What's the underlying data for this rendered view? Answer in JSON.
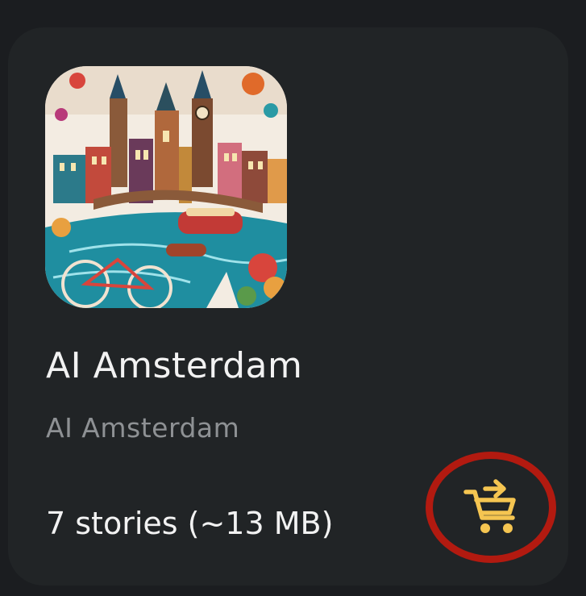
{
  "card": {
    "cover_alt": "AI Amsterdam cover art",
    "title": "AI Amsterdam",
    "subtitle": "AI Amsterdam",
    "meta": "7 stories (~13 MB)"
  },
  "action": {
    "icon": "cart-transfer-icon",
    "color": "#f5c551"
  },
  "highlight": {
    "color": "#b21a10"
  }
}
